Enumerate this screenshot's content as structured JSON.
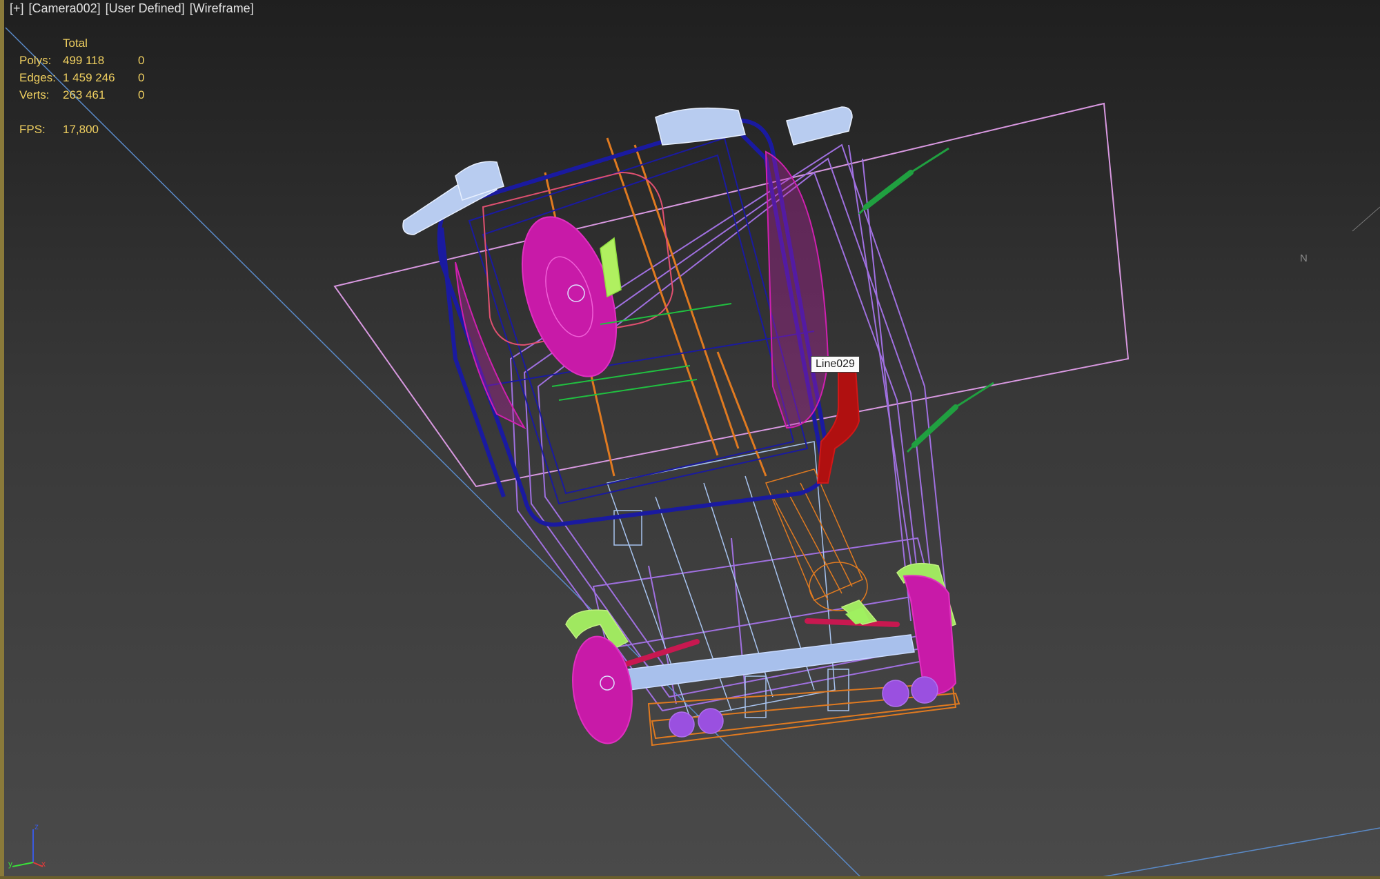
{
  "viewport_label": {
    "plus": "[+]",
    "camera": "[Camera002]",
    "shading_mode": "[User Defined]",
    "display": "[Wireframe]"
  },
  "stats": {
    "header": "Total",
    "rows": [
      {
        "label": "Polys:",
        "total": "499 118",
        "selected": "0"
      },
      {
        "label": "Edges:",
        "total": "1 459 246",
        "selected": "0"
      },
      {
        "label": "Verts:",
        "total": "263 461",
        "selected": "0"
      }
    ],
    "fps_label": "FPS:",
    "fps_value": "17,800"
  },
  "tooltip": "Line029",
  "compass_label": "N",
  "axis_labels": {
    "z": "z",
    "x": "x",
    "y": "y"
  },
  "colors": {
    "stats_text": "#f0d060",
    "background_top": "#1f1f1f",
    "background_bottom": "#4a4a4a",
    "wire_purple": "#a070e0",
    "wire_blue": "#1a1aa0",
    "wire_magenta": "#d020b0",
    "wire_orange": "#e07a20",
    "wire_lightblue": "#a8c4f0",
    "wire_green": "#20a040",
    "wire_lime": "#a0f060",
    "wire_red": "#c01010",
    "grid_line": "#5a8ac8"
  }
}
